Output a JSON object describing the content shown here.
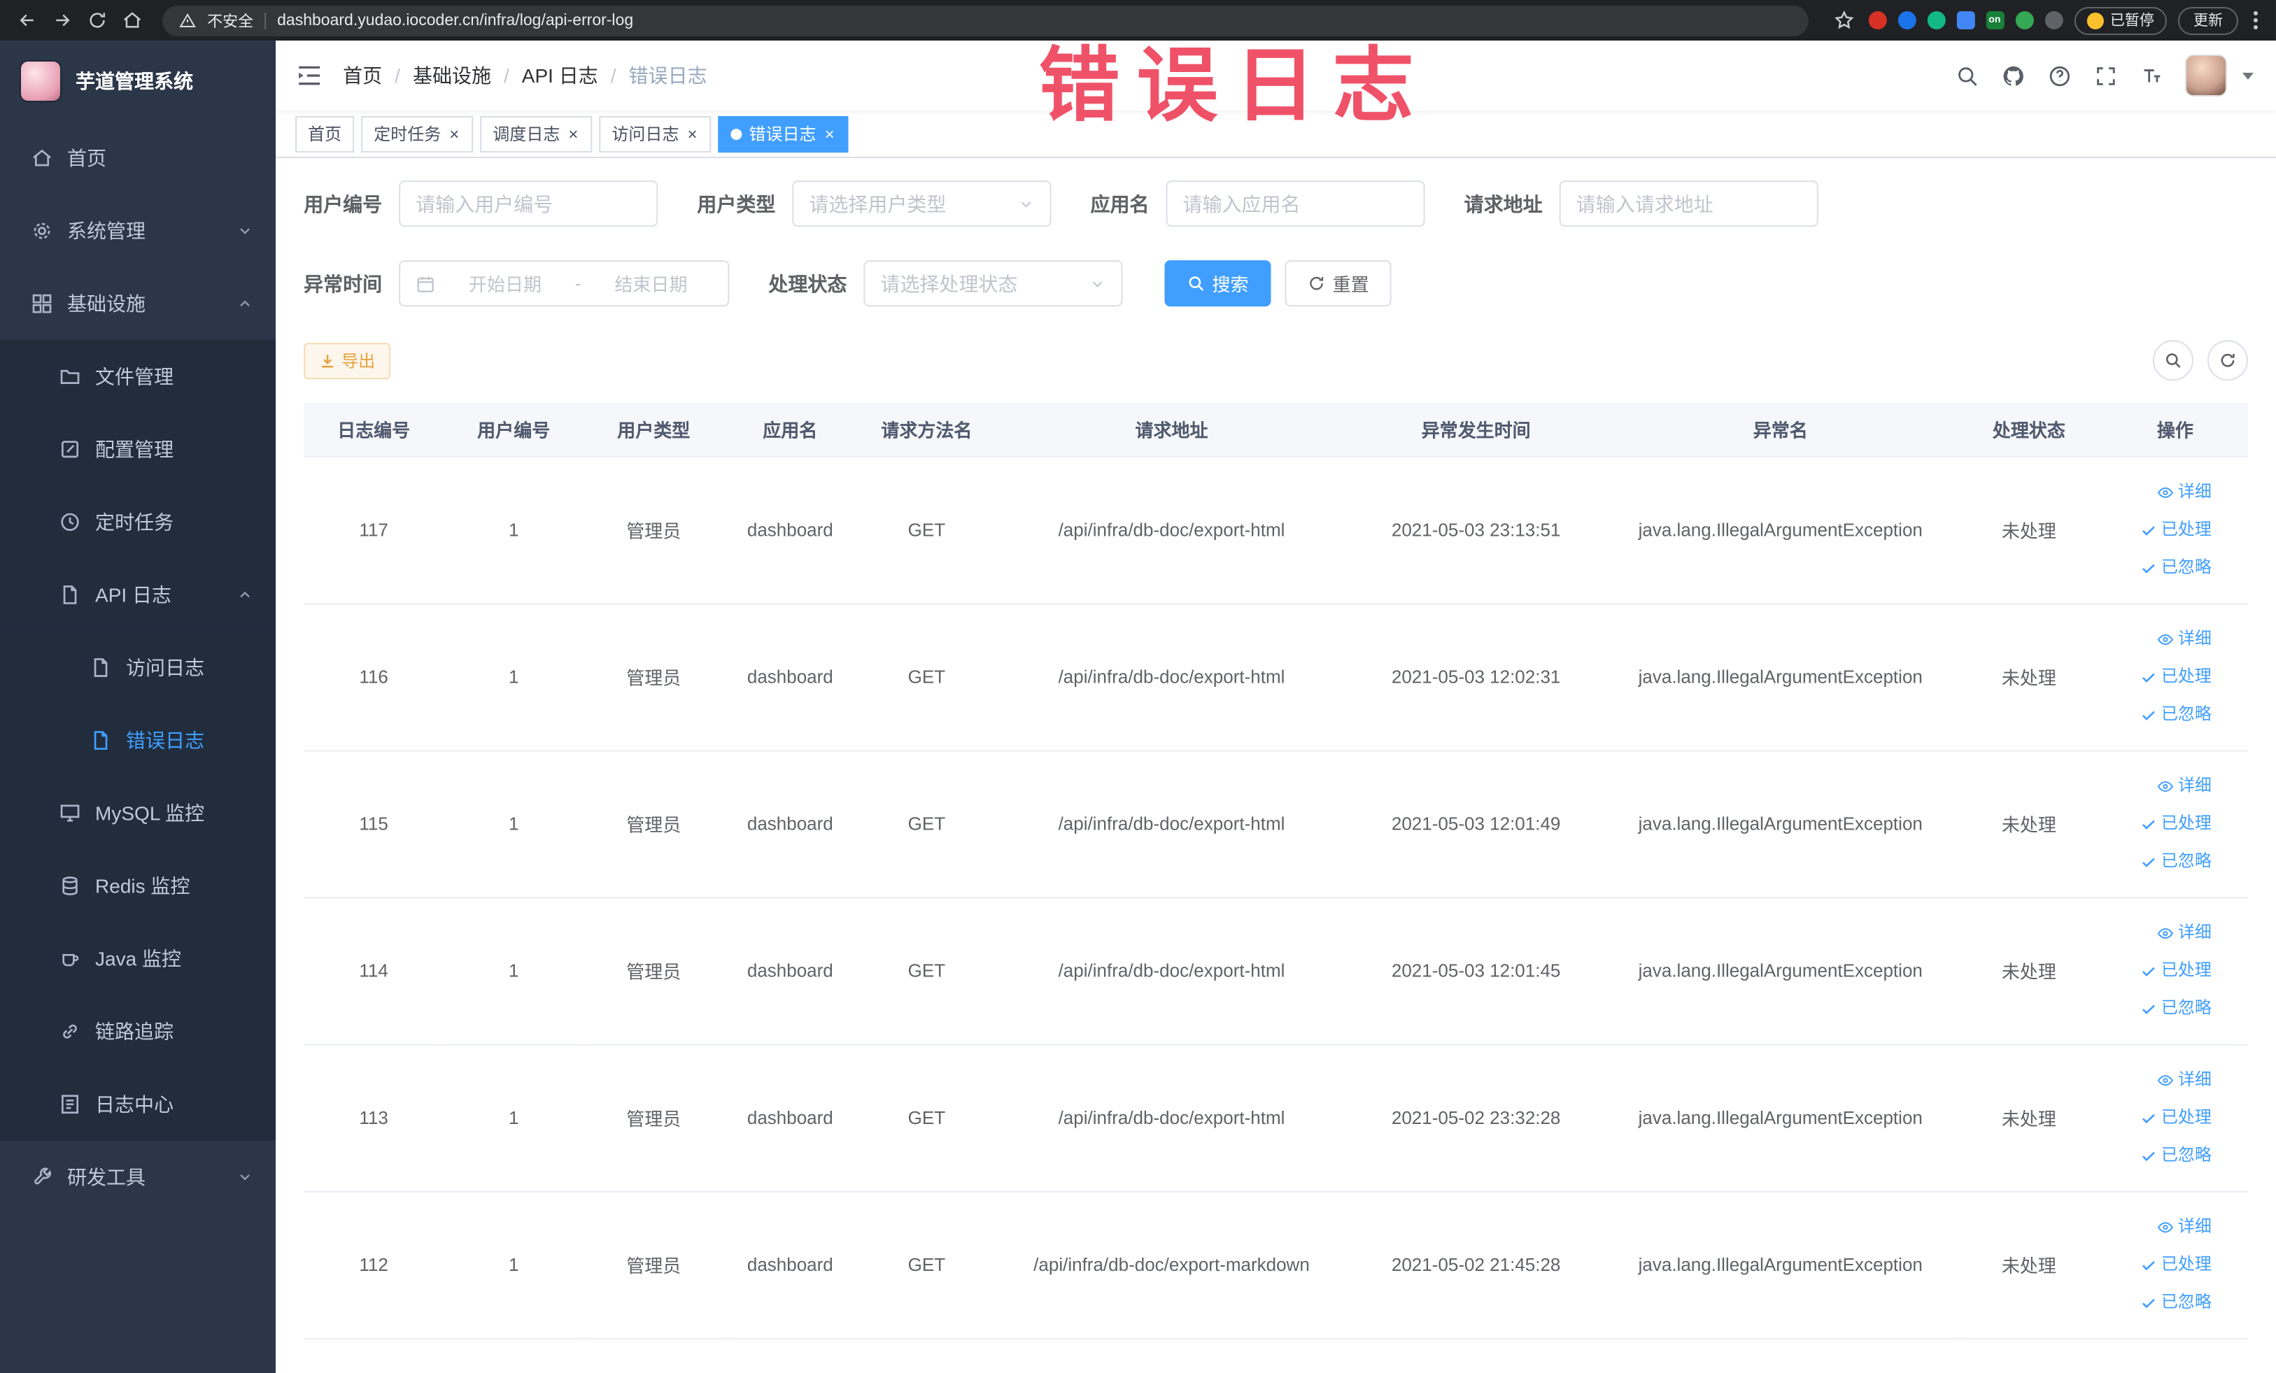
{
  "theme": {
    "primary": "#409eff",
    "warning": "#e6a23c",
    "sidebar_bg": "#2b3648",
    "submenu_bg": "#212d3d",
    "annotation_color": "#ee4058"
  },
  "browser": {
    "security_label": "不安全",
    "url": "dashboard.yudao.iocoder.cn/infra/log/api-error-log",
    "extension_badge": "on",
    "paused_label": "已暂停",
    "update_label": "更新"
  },
  "annotation": {
    "text": "错误日志"
  },
  "sidebar": {
    "logo_title": "芋道管理系统",
    "items": [
      {
        "label": "首页",
        "level": 0,
        "icon": "home"
      },
      {
        "label": "系统管理",
        "level": 0,
        "icon": "gear",
        "arrow": "down"
      },
      {
        "label": "基础设施",
        "level": 0,
        "icon": "grid",
        "arrow": "up"
      },
      {
        "label": "文件管理",
        "level": 1,
        "icon": "folder"
      },
      {
        "label": "配置管理",
        "level": 1,
        "icon": "edit"
      },
      {
        "label": "定时任务",
        "level": 1,
        "icon": "clock"
      },
      {
        "label": "API 日志",
        "level": 1,
        "icon": "doc",
        "arrow": "up"
      },
      {
        "label": "访问日志",
        "level": 2,
        "icon": "doc"
      },
      {
        "label": "错误日志",
        "level": 2,
        "icon": "doc",
        "active": true
      },
      {
        "label": "MySQL 监控",
        "level": 1,
        "icon": "monitor"
      },
      {
        "label": "Redis 监控",
        "level": 1,
        "icon": "db"
      },
      {
        "label": "Java 监控",
        "level": 1,
        "icon": "coffee"
      },
      {
        "label": "链路追踪",
        "level": 1,
        "icon": "link"
      },
      {
        "label": "日志中心",
        "level": 1,
        "icon": "log"
      },
      {
        "label": "研发工具",
        "level": 0,
        "icon": "wrench",
        "arrow": "down"
      }
    ]
  },
  "breadcrumb": {
    "separator": "/",
    "items": [
      "首页",
      "基础设施",
      "API 日志",
      "错误日志"
    ]
  },
  "tabs": [
    {
      "label": "首页",
      "closable": false,
      "active": false
    },
    {
      "label": "定时任务",
      "closable": true,
      "active": false
    },
    {
      "label": "调度日志",
      "closable": true,
      "active": false
    },
    {
      "label": "访问日志",
      "closable": true,
      "active": false
    },
    {
      "label": "错误日志",
      "closable": true,
      "active": true
    }
  ],
  "ui": {
    "close_glyph": "×"
  },
  "filters": {
    "user_id": {
      "label": "用户编号",
      "placeholder": "请输入用户编号"
    },
    "user_type": {
      "label": "用户类型",
      "placeholder": "请选择用户类型"
    },
    "app_name": {
      "label": "应用名",
      "placeholder": "请输入应用名"
    },
    "request_url": {
      "label": "请求地址",
      "placeholder": "请输入请求地址"
    },
    "time": {
      "label": "异常时间",
      "start_placeholder": "开始日期",
      "separator": "-",
      "end_placeholder": "结束日期"
    },
    "status": {
      "label": "处理状态",
      "placeholder": "请选择处理状态"
    },
    "search_label": "搜索",
    "reset_label": "重置"
  },
  "toolbar": {
    "export_label": "导出"
  },
  "table": {
    "columns": [
      "日志编号",
      "用户编号",
      "用户类型",
      "应用名",
      "请求方法名",
      "请求地址",
      "异常发生时间",
      "异常名",
      "处理状态",
      "操作"
    ],
    "actions": {
      "detail": "详细",
      "processed": "已处理",
      "ignored": "已忽略"
    },
    "rows": [
      {
        "id": "117",
        "user_id": "1",
        "user_type": "管理员",
        "app": "dashboard",
        "method": "GET",
        "url": "/api/infra/db-doc/export-html",
        "time": "2021-05-03 23:13:51",
        "exception": "java.lang.IllegalArgumentException",
        "status": "未处理"
      },
      {
        "id": "116",
        "user_id": "1",
        "user_type": "管理员",
        "app": "dashboard",
        "method": "GET",
        "url": "/api/infra/db-doc/export-html",
        "time": "2021-05-03 12:02:31",
        "exception": "java.lang.IllegalArgumentException",
        "status": "未处理"
      },
      {
        "id": "115",
        "user_id": "1",
        "user_type": "管理员",
        "app": "dashboard",
        "method": "GET",
        "url": "/api/infra/db-doc/export-html",
        "time": "2021-05-03 12:01:49",
        "exception": "java.lang.IllegalArgumentException",
        "status": "未处理"
      },
      {
        "id": "114",
        "user_id": "1",
        "user_type": "管理员",
        "app": "dashboard",
        "method": "GET",
        "url": "/api/infra/db-doc/export-html",
        "time": "2021-05-03 12:01:45",
        "exception": "java.lang.IllegalArgumentException",
        "status": "未处理"
      },
      {
        "id": "113",
        "user_id": "1",
        "user_type": "管理员",
        "app": "dashboard",
        "method": "GET",
        "url": "/api/infra/db-doc/export-html",
        "time": "2021-05-02 23:32:28",
        "exception": "java.lang.IllegalArgumentException",
        "status": "未处理"
      },
      {
        "id": "112",
        "user_id": "1",
        "user_type": "管理员",
        "app": "dashboard",
        "method": "GET",
        "url": "/api/infra/db-doc/export-markdown",
        "time": "2021-05-02 21:45:28",
        "exception": "java.lang.IllegalArgumentException",
        "status": "未处理"
      }
    ]
  }
}
